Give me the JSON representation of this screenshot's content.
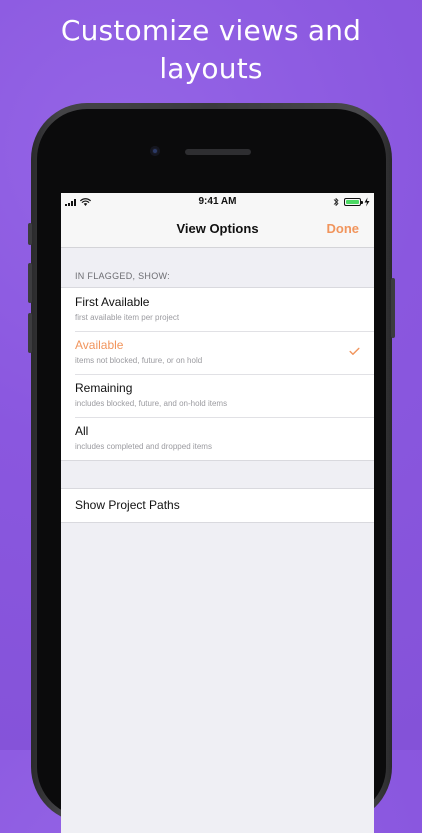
{
  "headline": {
    "line1": "Customize views and",
    "line2": "layouts"
  },
  "status_bar": {
    "time": "9:41 AM"
  },
  "nav": {
    "title": "View Options",
    "done_label": "Done"
  },
  "section": {
    "header": "IN FLAGGED, SHOW:"
  },
  "options": [
    {
      "title": "First Available",
      "subtitle": "first available item per project",
      "selected": false
    },
    {
      "title": "Available",
      "subtitle": "items not blocked, future, or on hold",
      "selected": true
    },
    {
      "title": "Remaining",
      "subtitle": "includes blocked, future, and on-hold items",
      "selected": false
    },
    {
      "title": "All",
      "subtitle": "includes completed and dropped items",
      "selected": false
    }
  ],
  "paths": {
    "label": "Show Project Paths"
  },
  "colors": {
    "accent": "#f1955d",
    "background": "#8b59e0",
    "screen_bg": "#efeff4",
    "battery": "#4cd964"
  }
}
